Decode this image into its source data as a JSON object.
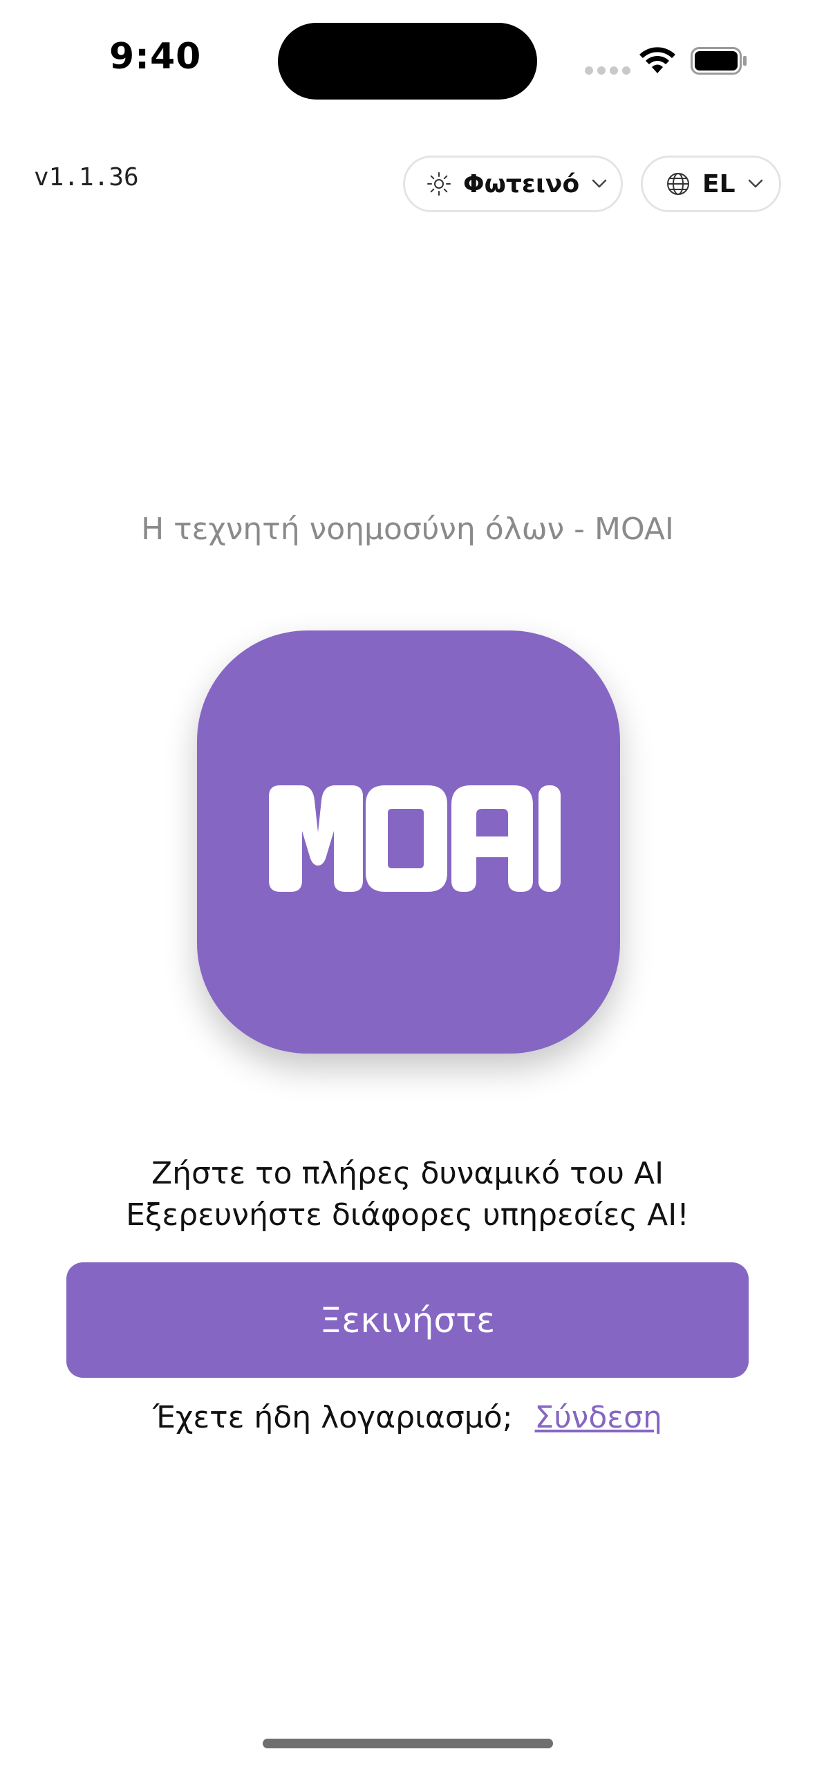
{
  "status_bar": {
    "time": "9:40"
  },
  "header": {
    "version": "v1.1.36",
    "theme": {
      "label": "Φωτεινό",
      "icon": "sun-icon"
    },
    "language": {
      "label": "EL",
      "icon": "globe-icon"
    }
  },
  "main": {
    "tagline": "Η τεχνητή νοημοσύνη όλων - MOAI",
    "logo_text": "MOAI",
    "intro_line1": "Ζήστε το πλήρες δυναμικό του AI",
    "intro_line2": "Εξερευνήστε διάφορες υπηρεσίες AI!",
    "start_button": "Ξεκινήστε",
    "login_prompt": "Έχετε ήδη λογαριασμό;",
    "login_link": "Σύνδεση"
  },
  "colors": {
    "accent": "#8566c3",
    "muted_text": "#8a8a8a"
  }
}
